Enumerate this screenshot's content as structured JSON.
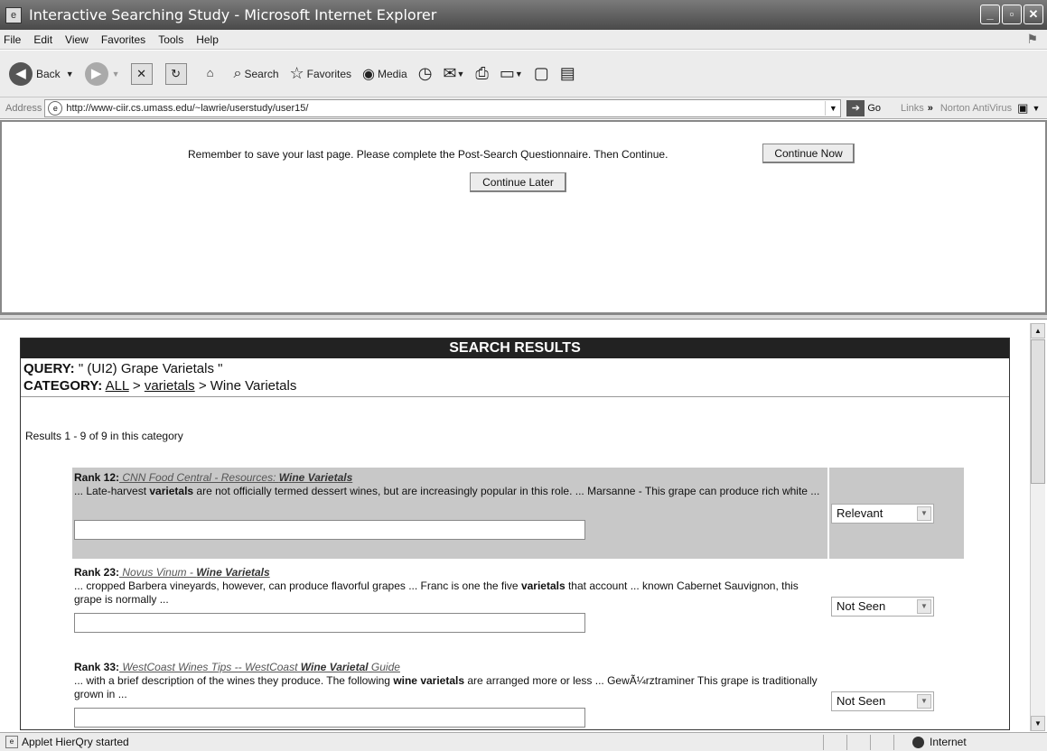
{
  "window": {
    "title": "Interactive Searching Study - Microsoft Internet Explorer"
  },
  "menu": [
    "File",
    "Edit",
    "View",
    "Favorites",
    "Tools",
    "Help"
  ],
  "toolbar": {
    "back": "Back",
    "search": "Search",
    "favorites": "Favorites",
    "media": "Media"
  },
  "address": {
    "label": "Address",
    "url": "http://www-ciir.cs.umass.edu/~lawrie/userstudy/user15/",
    "go": "Go",
    "links": "Links",
    "norton": "Norton AntiVirus"
  },
  "top": {
    "message": "Remember to save your last page. Please complete the Post-Search Questionnaire.  Then Continue.",
    "continue_now": "Continue Now",
    "continue_later": "Continue Later"
  },
  "results": {
    "header": "SEARCH RESULTS",
    "query_label": "QUERY:",
    "query_value": "\" (UI2) Grape Varietals \"",
    "category_label": "CATEGORY:",
    "cat_all": "ALL",
    "cat_sep1": ">",
    "cat_varietals": "varietals",
    "cat_sep2": "> Wine Varietals",
    "count": "Results 1 - 9 of 9 in this category",
    "items": [
      {
        "rank": "Rank 12:",
        "link_pre": " CNN Food Central - Resources: ",
        "link_bold": "Wine Varietals",
        "snippet_1": "... Late-harvest ",
        "snippet_b1": "varietals",
        "snippet_2": " are not officially termed dessert wines, but are increasingly popular in this role. ... Marsanne - This grape can produce rich white ...",
        "judgment": "Relevant"
      },
      {
        "rank": "Rank 23:",
        "link_pre": " Novus Vinum - ",
        "link_bold": "Wine Varietals",
        "snippet_1": "... cropped Barbera vineyards, however, can produce flavorful grapes ... Franc is one the five ",
        "snippet_b1": "varietals",
        "snippet_2": " that account ... known Cabernet Sauvignon, this grape is normally ...",
        "judgment": "Not Seen"
      },
      {
        "rank": "Rank 33:",
        "link_pre": " WestCoast Wines Tips -- WestCoast ",
        "link_bold": "Wine Varietal",
        "link_post": " Guide",
        "snippet_1": "... with a brief description of the wines they produce. The following ",
        "snippet_b1": "wine varietals",
        "snippet_2": " are arranged more or less ... GewÃ¼rztraminer This grape is traditionally grown in ...",
        "judgment": "Not Seen"
      }
    ]
  },
  "status": {
    "text": "Applet HierQry started",
    "zone": "Internet"
  }
}
